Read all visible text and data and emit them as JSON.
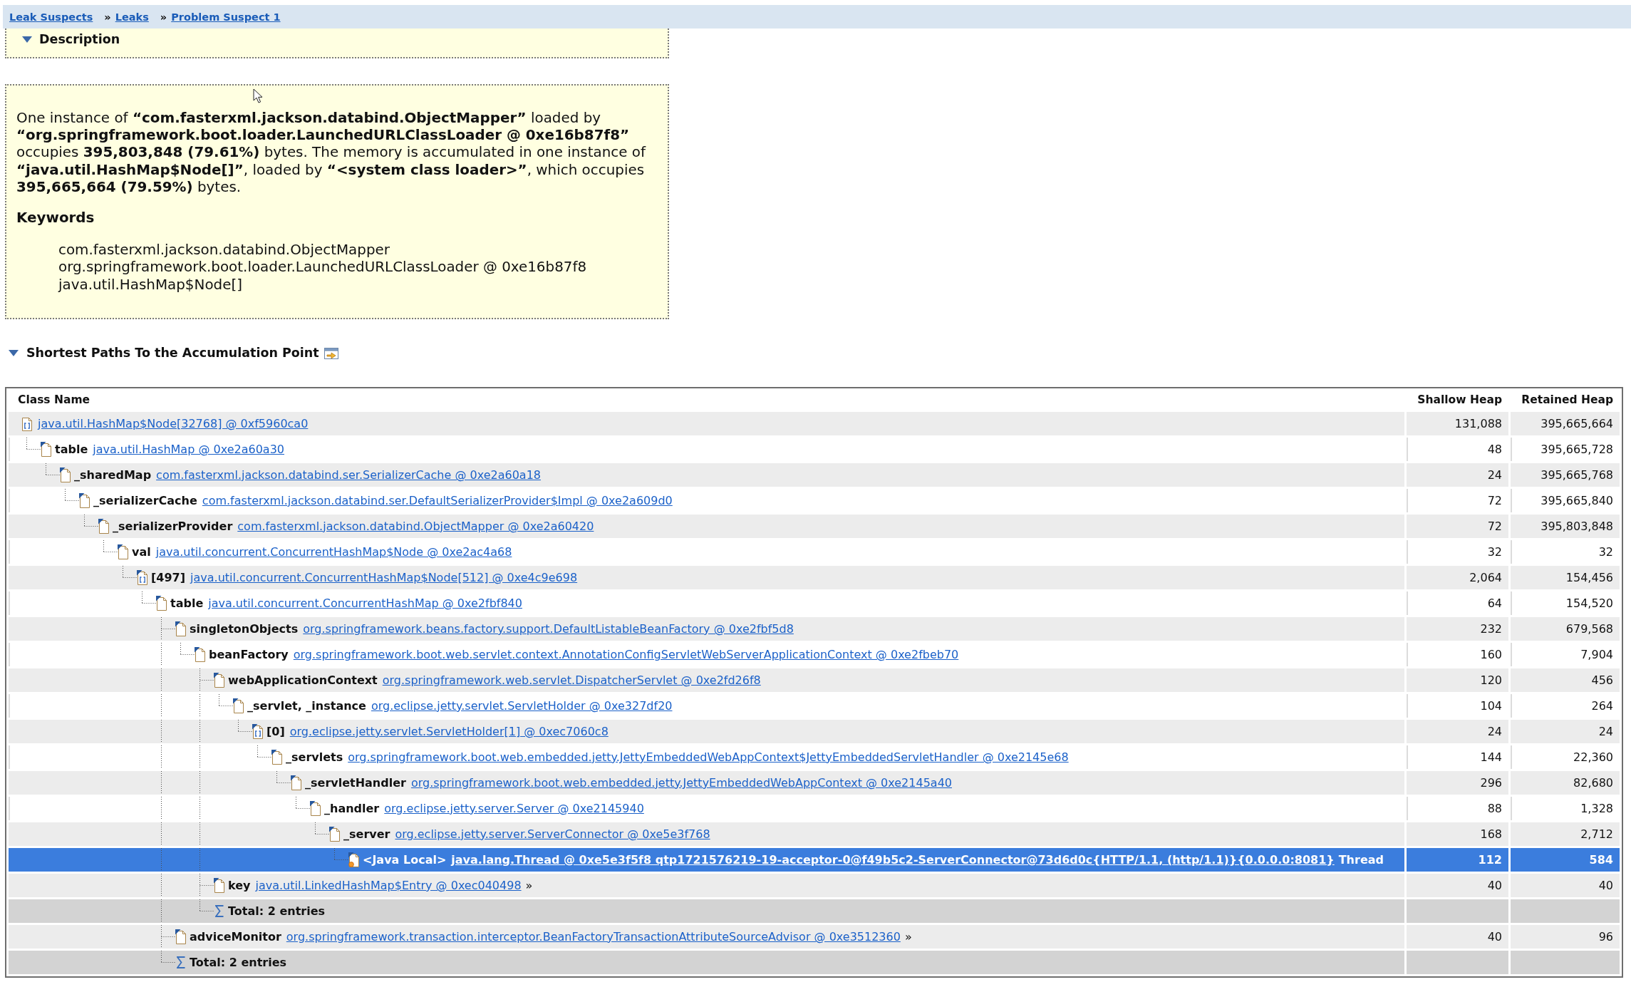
{
  "breadcrumb": [
    {
      "label": "Leak Suspects"
    },
    {
      "separator": "»",
      "label": "Leaks"
    },
    {
      "separator": "»",
      "label": "Problem Suspect 1"
    }
  ],
  "description": {
    "title": "Description",
    "expanded": true,
    "text": "One instance of **“com.fasterxml.jackson.databind.ObjectMapper”** loaded by **“org.springframework.boot.loader.LaunchedURLClassLoader @ 0xe16b87f8”** occupies **395,803,848 (79.61%)** bytes. The memory is accumulated in one instance of **“java.util.HashMap$Node[]”**, loaded by **“<system class loader>”**, which occupies **395,665,664 (79.59%)** bytes.",
    "keywords_title": "Keywords",
    "keywords": [
      "com.fasterxml.jackson.databind.ObjectMapper",
      "org.springframework.boot.loader.LaunchedURLClassLoader @ 0xe16b87f8",
      "java.util.HashMap$Node[]"
    ]
  },
  "shortest_paths": {
    "title": "Shortest Paths To the Accumulation Point",
    "expanded": true,
    "columns": [
      "Class Name",
      "Shallow Heap",
      "Retained Heap"
    ],
    "rows": [
      {
        "kind": "array",
        "link": "java.util.HashMap$Node[32768] @ 0xf5960ca0",
        "shallow_heap": "131,088",
        "retained_heap": "395,665,664",
        "selected": false,
        "children": [
          {
            "kind": "object",
            "field": "table",
            "link": "java.util.HashMap @ 0xe2a60a30",
            "shallow_heap": "48",
            "retained_heap": "395,665,728",
            "selected": false,
            "children": [
              {
                "kind": "object",
                "field": "_sharedMap",
                "link": "com.fasterxml.jackson.databind.ser.SerializerCache @ 0xe2a60a18",
                "shallow_heap": "24",
                "retained_heap": "395,665,768",
                "selected": false,
                "children": [
                  {
                    "kind": "object",
                    "field": "_serializerCache",
                    "link": "com.fasterxml.jackson.databind.ser.DefaultSerializerProvider$Impl @ 0xe2a609d0",
                    "shallow_heap": "72",
                    "retained_heap": "395,665,840",
                    "selected": false,
                    "children": [
                      {
                        "kind": "object",
                        "field": "_serializerProvider",
                        "link": "com.fasterxml.jackson.databind.ObjectMapper @ 0xe2a60420",
                        "shallow_heap": "72",
                        "retained_heap": "395,803,848",
                        "selected": false,
                        "children": [
                          {
                            "kind": "object",
                            "field": "val",
                            "link": "java.util.concurrent.ConcurrentHashMap$Node @ 0xe2ac4a68",
                            "shallow_heap": "32",
                            "retained_heap": "32",
                            "selected": false,
                            "children": [
                              {
                                "kind": "array",
                                "field": "[497]",
                                "link": "java.util.concurrent.ConcurrentHashMap$Node[512] @ 0xe4c9e698",
                                "shallow_heap": "2,064",
                                "retained_heap": "154,456",
                                "selected": false,
                                "children": [
                                  {
                                    "kind": "object",
                                    "field": "table",
                                    "link": "java.util.concurrent.ConcurrentHashMap @ 0xe2fbf840",
                                    "shallow_heap": "64",
                                    "retained_heap": "154,520",
                                    "selected": false,
                                    "children": [
                                      {
                                        "kind": "object",
                                        "field": "singletonObjects",
                                        "link": "org.springframework.beans.factory.support.DefaultListableBeanFactory @ 0xe2fbf5d8",
                                        "shallow_heap": "232",
                                        "retained_heap": "679,568",
                                        "selected": false,
                                        "children": [
                                          {
                                            "kind": "object",
                                            "field": "beanFactory",
                                            "link": "org.springframework.boot.web.servlet.context.AnnotationConfigServletWebServerApplicationContext @ 0xe2fbeb70",
                                            "shallow_heap": "160",
                                            "retained_heap": "7,904",
                                            "selected": false,
                                            "children": [
                                              {
                                                "kind": "object",
                                                "field": "webApplicationContext",
                                                "link": "org.springframework.web.servlet.DispatcherServlet @ 0xe2fd26f8",
                                                "shallow_heap": "120",
                                                "retained_heap": "456",
                                                "selected": false,
                                                "children": [
                                                  {
                                                    "kind": "object",
                                                    "field": "_servlet, _instance",
                                                    "link": "org.eclipse.jetty.servlet.ServletHolder @ 0xe327df20",
                                                    "shallow_heap": "104",
                                                    "retained_heap": "264",
                                                    "selected": false,
                                                    "children": [
                                                      {
                                                        "kind": "array",
                                                        "field": "[0]",
                                                        "link": "org.eclipse.jetty.servlet.ServletHolder[1] @ 0xec7060c8",
                                                        "shallow_heap": "24",
                                                        "retained_heap": "24",
                                                        "selected": false,
                                                        "children": [
                                                          {
                                                            "kind": "object",
                                                            "field": "_servlets",
                                                            "link": "org.springframework.boot.web.embedded.jetty.JettyEmbeddedWebAppContext$JettyEmbeddedServletHandler @ 0xe2145e68",
                                                            "shallow_heap": "144",
                                                            "retained_heap": "22,360",
                                                            "selected": false,
                                                            "children": [
                                                              {
                                                                "kind": "object",
                                                                "field": "_servletHandler",
                                                                "link": "org.springframework.boot.web.embedded.jetty.JettyEmbeddedWebAppContext @ 0xe2145a40",
                                                                "shallow_heap": "296",
                                                                "retained_heap": "82,680",
                                                                "selected": false,
                                                                "children": [
                                                                  {
                                                                    "kind": "object",
                                                                    "field": "_handler",
                                                                    "link": "org.eclipse.jetty.server.Server @ 0xe2145940",
                                                                    "shallow_heap": "88",
                                                                    "retained_heap": "1,328",
                                                                    "selected": false,
                                                                    "children": [
                                                                      {
                                                                        "kind": "object",
                                                                        "field": "_server",
                                                                        "link": "org.eclipse.jetty.server.ServerConnector @ 0xe5e3f768",
                                                                        "shallow_heap": "168",
                                                                        "retained_heap": "2,712",
                                                                        "selected": false,
                                                                        "children": [
                                                                          {
                                                                            "kind": "gc_root",
                                                                            "field": "<Java Local>",
                                                                            "link": "java.lang.Thread @ 0xe5e3f5f8 qtp1721576219-19-acceptor-0@f49b5c2-ServerConnector@73d6d0c{HTTP/1.1, (http/1.1)}{0.0.0.0:8081}",
                                                                            "suffix": "Thread",
                                                                            "shallow_heap": "112",
                                                                            "retained_heap": "584",
                                                                            "selected": true
                                                                          }
                                                                        ]
                                                                      }
                                                                    ]
                                                                  }
                                                                ]
                                                              }
                                                            ]
                                                          }
                                                        ]
                                                      }
                                                    ]
                                                  }
                                                ]
                                              },
                                              {
                                                "kind": "object",
                                                "field": "key",
                                                "link": "java.util.LinkedHashMap$Entry @ 0xec040498",
                                                "suffix": "»",
                                                "shallow_heap": "40",
                                                "retained_heap": "40",
                                                "selected": false
                                              },
                                              {
                                                "kind": "total",
                                                "label": "Total: 2 entries",
                                                "selected": false
                                              }
                                            ]
                                          }
                                        ]
                                      },
                                      {
                                        "kind": "object",
                                        "field": "adviceMonitor",
                                        "link": "org.springframework.transaction.interceptor.BeanFactoryTransactionAttributeSourceAdvisor @ 0xe3512360",
                                        "suffix": "»",
                                        "shallow_heap": "40",
                                        "retained_heap": "96",
                                        "selected": false
                                      },
                                      {
                                        "kind": "total",
                                        "label": "Total: 2 entries",
                                        "selected": false
                                      }
                                    ]
                                  }
                                ]
                              }
                            ]
                          }
                        ]
                      }
                    ]
                  }
                ]
              }
            ]
          }
        ]
      }
    ]
  }
}
